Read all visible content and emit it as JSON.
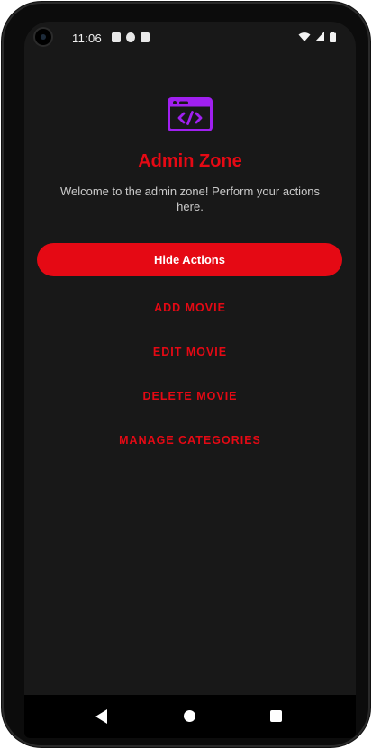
{
  "status_bar": {
    "time": "11:06"
  },
  "header": {
    "icon": "code-window-icon",
    "title": "Admin Zone",
    "subtitle": "Welcome to the admin zone! Perform your actions here."
  },
  "main": {
    "toggle_label": "Hide Actions",
    "actions": [
      {
        "label": "ADD MOVIE"
      },
      {
        "label": "EDIT MOVIE"
      },
      {
        "label": "DELETE MOVIE"
      },
      {
        "label": "MANAGE CATEGORIES"
      }
    ]
  },
  "nav": {
    "back_icon": "back-icon",
    "home_icon": "home-icon",
    "recents_icon": "recents-icon"
  },
  "colors": {
    "accent": "#e50914",
    "background": "#181818",
    "icon_purple": "#a020f0"
  }
}
